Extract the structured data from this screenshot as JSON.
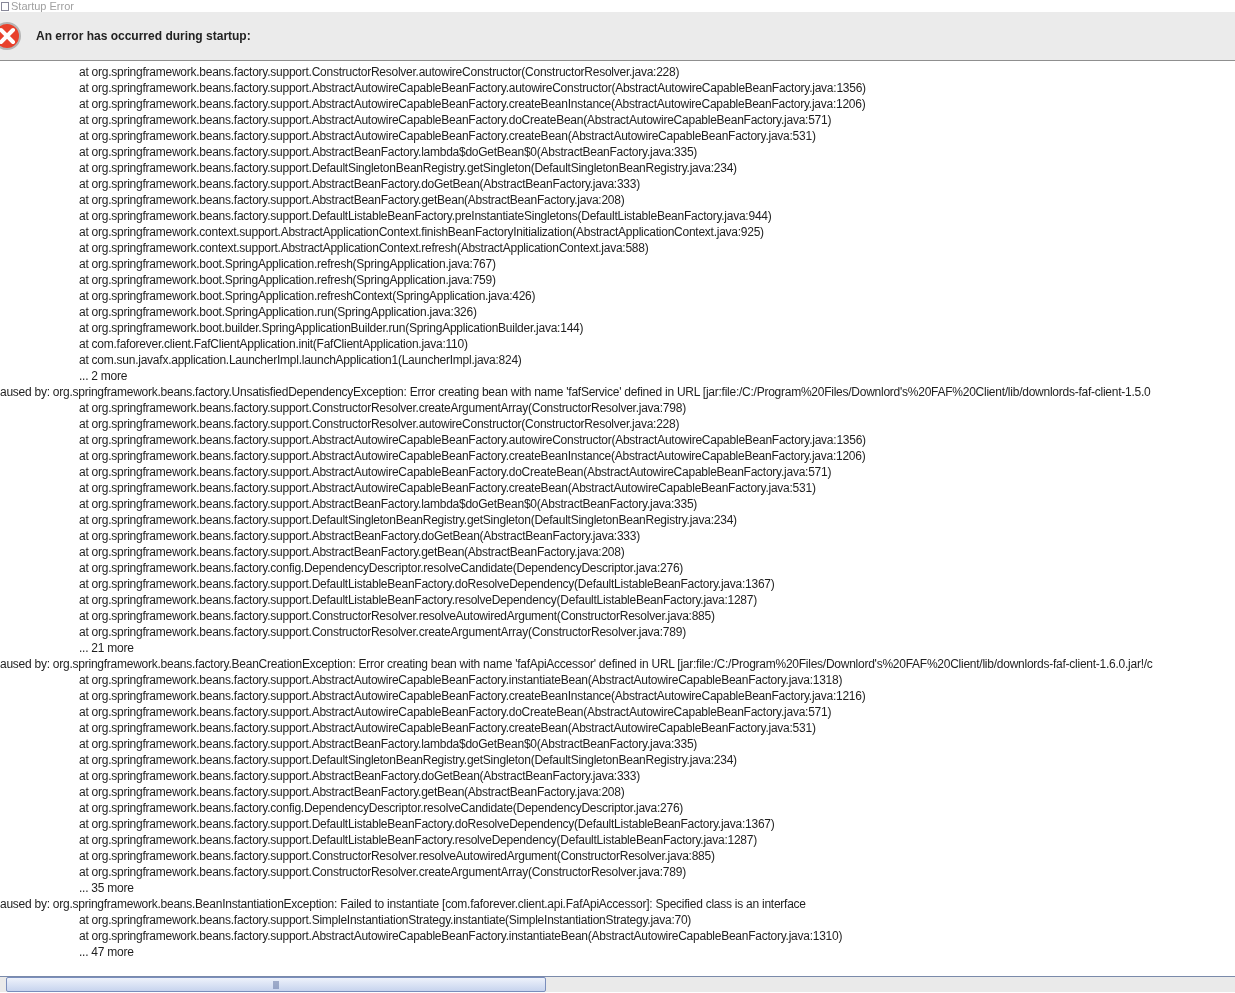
{
  "window": {
    "title": "Startup Error"
  },
  "header": {
    "message": "An error has occurred during startup:"
  },
  "trace": [
    {
      "kind": "at",
      "text": "at org.springframework.beans.factory.support.ConstructorResolver.autowireConstructor(ConstructorResolver.java:228)"
    },
    {
      "kind": "at",
      "text": "at org.springframework.beans.factory.support.AbstractAutowireCapableBeanFactory.autowireConstructor(AbstractAutowireCapableBeanFactory.java:1356)"
    },
    {
      "kind": "at",
      "text": "at org.springframework.beans.factory.support.AbstractAutowireCapableBeanFactory.createBeanInstance(AbstractAutowireCapableBeanFactory.java:1206)"
    },
    {
      "kind": "at",
      "text": "at org.springframework.beans.factory.support.AbstractAutowireCapableBeanFactory.doCreateBean(AbstractAutowireCapableBeanFactory.java:571)"
    },
    {
      "kind": "at",
      "text": "at org.springframework.beans.factory.support.AbstractAutowireCapableBeanFactory.createBean(AbstractAutowireCapableBeanFactory.java:531)"
    },
    {
      "kind": "at",
      "text": "at org.springframework.beans.factory.support.AbstractBeanFactory.lambda$doGetBean$0(AbstractBeanFactory.java:335)"
    },
    {
      "kind": "at",
      "text": "at org.springframework.beans.factory.support.DefaultSingletonBeanRegistry.getSingleton(DefaultSingletonBeanRegistry.java:234)"
    },
    {
      "kind": "at",
      "text": "at org.springframework.beans.factory.support.AbstractBeanFactory.doGetBean(AbstractBeanFactory.java:333)"
    },
    {
      "kind": "at",
      "text": "at org.springframework.beans.factory.support.AbstractBeanFactory.getBean(AbstractBeanFactory.java:208)"
    },
    {
      "kind": "at",
      "text": "at org.springframework.beans.factory.support.DefaultListableBeanFactory.preInstantiateSingletons(DefaultListableBeanFactory.java:944)"
    },
    {
      "kind": "at",
      "text": "at org.springframework.context.support.AbstractApplicationContext.finishBeanFactoryInitialization(AbstractApplicationContext.java:925)"
    },
    {
      "kind": "at",
      "text": "at org.springframework.context.support.AbstractApplicationContext.refresh(AbstractApplicationContext.java:588)"
    },
    {
      "kind": "at",
      "text": "at org.springframework.boot.SpringApplication.refresh(SpringApplication.java:767)"
    },
    {
      "kind": "at",
      "text": "at org.springframework.boot.SpringApplication.refresh(SpringApplication.java:759)"
    },
    {
      "kind": "at",
      "text": "at org.springframework.boot.SpringApplication.refreshContext(SpringApplication.java:426)"
    },
    {
      "kind": "at",
      "text": "at org.springframework.boot.SpringApplication.run(SpringApplication.java:326)"
    },
    {
      "kind": "at",
      "text": "at org.springframework.boot.builder.SpringApplicationBuilder.run(SpringApplicationBuilder.java:144)"
    },
    {
      "kind": "at",
      "text": "at com.faforever.client.FafClientApplication.init(FafClientApplication.java:110)"
    },
    {
      "kind": "at",
      "text": "at com.sun.javafx.application.LauncherImpl.launchApplication1(LauncherImpl.java:824)"
    },
    {
      "kind": "at",
      "text": "... 2 more"
    },
    {
      "kind": "caused",
      "text": "aused by: org.springframework.beans.factory.UnsatisfiedDependencyException: Error creating bean with name 'fafService' defined in URL [jar:file:/C:/Program%20Files/Downlord's%20FAF%20Client/lib/downlords-faf-client-1.5.0"
    },
    {
      "kind": "at",
      "text": "at org.springframework.beans.factory.support.ConstructorResolver.createArgumentArray(ConstructorResolver.java:798)"
    },
    {
      "kind": "at",
      "text": "at org.springframework.beans.factory.support.ConstructorResolver.autowireConstructor(ConstructorResolver.java:228)"
    },
    {
      "kind": "at",
      "text": "at org.springframework.beans.factory.support.AbstractAutowireCapableBeanFactory.autowireConstructor(AbstractAutowireCapableBeanFactory.java:1356)"
    },
    {
      "kind": "at",
      "text": "at org.springframework.beans.factory.support.AbstractAutowireCapableBeanFactory.createBeanInstance(AbstractAutowireCapableBeanFactory.java:1206)"
    },
    {
      "kind": "at",
      "text": "at org.springframework.beans.factory.support.AbstractAutowireCapableBeanFactory.doCreateBean(AbstractAutowireCapableBeanFactory.java:571)"
    },
    {
      "kind": "at",
      "text": "at org.springframework.beans.factory.support.AbstractAutowireCapableBeanFactory.createBean(AbstractAutowireCapableBeanFactory.java:531)"
    },
    {
      "kind": "at",
      "text": "at org.springframework.beans.factory.support.AbstractBeanFactory.lambda$doGetBean$0(AbstractBeanFactory.java:335)"
    },
    {
      "kind": "at",
      "text": "at org.springframework.beans.factory.support.DefaultSingletonBeanRegistry.getSingleton(DefaultSingletonBeanRegistry.java:234)"
    },
    {
      "kind": "at",
      "text": "at org.springframework.beans.factory.support.AbstractBeanFactory.doGetBean(AbstractBeanFactory.java:333)"
    },
    {
      "kind": "at",
      "text": "at org.springframework.beans.factory.support.AbstractBeanFactory.getBean(AbstractBeanFactory.java:208)"
    },
    {
      "kind": "at",
      "text": "at org.springframework.beans.factory.config.DependencyDescriptor.resolveCandidate(DependencyDescriptor.java:276)"
    },
    {
      "kind": "at",
      "text": "at org.springframework.beans.factory.support.DefaultListableBeanFactory.doResolveDependency(DefaultListableBeanFactory.java:1367)"
    },
    {
      "kind": "at",
      "text": "at org.springframework.beans.factory.support.DefaultListableBeanFactory.resolveDependency(DefaultListableBeanFactory.java:1287)"
    },
    {
      "kind": "at",
      "text": "at org.springframework.beans.factory.support.ConstructorResolver.resolveAutowiredArgument(ConstructorResolver.java:885)"
    },
    {
      "kind": "at",
      "text": "at org.springframework.beans.factory.support.ConstructorResolver.createArgumentArray(ConstructorResolver.java:789)"
    },
    {
      "kind": "at",
      "text": "... 21 more"
    },
    {
      "kind": "caused",
      "text": "aused by: org.springframework.beans.factory.BeanCreationException: Error creating bean with name 'fafApiAccessor' defined in URL [jar:file:/C:/Program%20Files/Downlord's%20FAF%20Client/lib/downlords-faf-client-1.6.0.jar!/c"
    },
    {
      "kind": "at",
      "text": "at org.springframework.beans.factory.support.AbstractAutowireCapableBeanFactory.instantiateBean(AbstractAutowireCapableBeanFactory.java:1318)"
    },
    {
      "kind": "at",
      "text": "at org.springframework.beans.factory.support.AbstractAutowireCapableBeanFactory.createBeanInstance(AbstractAutowireCapableBeanFactory.java:1216)"
    },
    {
      "kind": "at",
      "text": "at org.springframework.beans.factory.support.AbstractAutowireCapableBeanFactory.doCreateBean(AbstractAutowireCapableBeanFactory.java:571)"
    },
    {
      "kind": "at",
      "text": "at org.springframework.beans.factory.support.AbstractAutowireCapableBeanFactory.createBean(AbstractAutowireCapableBeanFactory.java:531)"
    },
    {
      "kind": "at",
      "text": "at org.springframework.beans.factory.support.AbstractBeanFactory.lambda$doGetBean$0(AbstractBeanFactory.java:335)"
    },
    {
      "kind": "at",
      "text": "at org.springframework.beans.factory.support.DefaultSingletonBeanRegistry.getSingleton(DefaultSingletonBeanRegistry.java:234)"
    },
    {
      "kind": "at",
      "text": "at org.springframework.beans.factory.support.AbstractBeanFactory.doGetBean(AbstractBeanFactory.java:333)"
    },
    {
      "kind": "at",
      "text": "at org.springframework.beans.factory.support.AbstractBeanFactory.getBean(AbstractBeanFactory.java:208)"
    },
    {
      "kind": "at",
      "text": "at org.springframework.beans.factory.config.DependencyDescriptor.resolveCandidate(DependencyDescriptor.java:276)"
    },
    {
      "kind": "at",
      "text": "at org.springframework.beans.factory.support.DefaultListableBeanFactory.doResolveDependency(DefaultListableBeanFactory.java:1367)"
    },
    {
      "kind": "at",
      "text": "at org.springframework.beans.factory.support.DefaultListableBeanFactory.resolveDependency(DefaultListableBeanFactory.java:1287)"
    },
    {
      "kind": "at",
      "text": "at org.springframework.beans.factory.support.ConstructorResolver.resolveAutowiredArgument(ConstructorResolver.java:885)"
    },
    {
      "kind": "at",
      "text": "at org.springframework.beans.factory.support.ConstructorResolver.createArgumentArray(ConstructorResolver.java:789)"
    },
    {
      "kind": "at",
      "text": "... 35 more"
    },
    {
      "kind": "caused",
      "text": "aused by: org.springframework.beans.BeanInstantiationException: Failed to instantiate [com.faforever.client.api.FafApiAccessor]: Specified class is an interface"
    },
    {
      "kind": "at",
      "text": "at org.springframework.beans.factory.support.SimpleInstantiationStrategy.instantiate(SimpleInstantiationStrategy.java:70)"
    },
    {
      "kind": "at",
      "text": "at org.springframework.beans.factory.support.AbstractAutowireCapableBeanFactory.instantiateBean(AbstractAutowireCapableBeanFactory.java:1310)"
    },
    {
      "kind": "at",
      "text": "... 47 more"
    }
  ]
}
